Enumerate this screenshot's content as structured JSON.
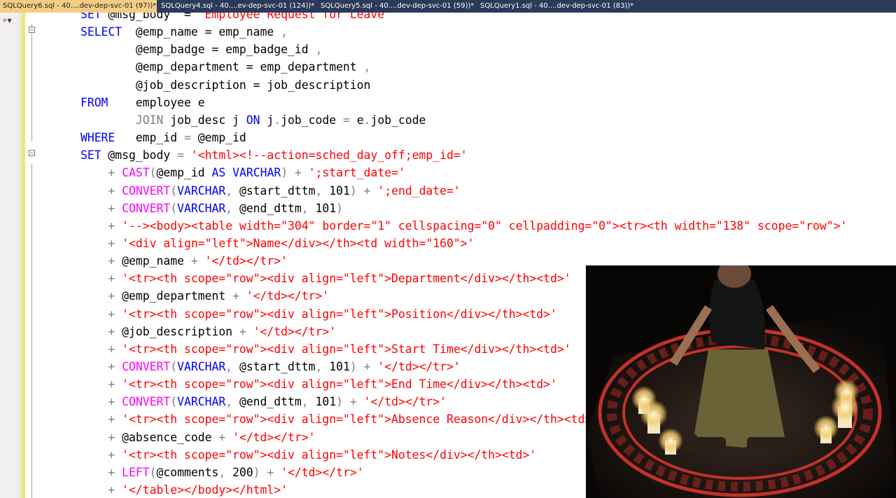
{
  "tabs": [
    {
      "label": "SQLQuery6.sql - 40....dev-dep-svc-01 (97))*",
      "active": true
    },
    {
      "label": "SQLQuery4.sql - 40....ev-dep-svc-01 (124))*",
      "active": false
    },
    {
      "label": "SQLQuery5.sql - 40....dev-dep-svc-01 (59))*",
      "active": false
    },
    {
      "label": "SQLQuery1.sql - 40....dev-dep-svc-01 (83))*",
      "active": false
    }
  ],
  "code_lines": [
    [
      [
        "",
        "        "
      ],
      [
        "kw",
        "SET"
      ],
      [
        "",
        " @msg_body  = "
      ],
      [
        "str",
        "'Employee Request for Leave'"
      ]
    ],
    [
      [
        "",
        "        "
      ],
      [
        "kw",
        "SELECT"
      ],
      [
        "",
        "  @emp_name = emp_name "
      ],
      [
        "gray",
        ","
      ]
    ],
    [
      [
        "",
        "                "
      ],
      [
        "",
        "@emp_badge = emp_badge_id "
      ],
      [
        "gray",
        ","
      ]
    ],
    [
      [
        "",
        "                "
      ],
      [
        "",
        "@emp_department = emp_department "
      ],
      [
        "gray",
        ","
      ]
    ],
    [
      [
        "",
        "                "
      ],
      [
        "",
        "@job_description = job_description"
      ]
    ],
    [
      [
        "",
        "        "
      ],
      [
        "kw",
        "FROM"
      ],
      [
        "",
        "    employee e"
      ]
    ],
    [
      [
        "",
        "                "
      ],
      [
        "gray",
        "JOIN"
      ],
      [
        "",
        " job_desc j "
      ],
      [
        "kw",
        "ON"
      ],
      [
        "",
        " j"
      ],
      [
        "gray",
        "."
      ],
      [
        "",
        "job_code "
      ],
      [
        "gray",
        "="
      ],
      [
        "",
        " e"
      ],
      [
        "gray",
        "."
      ],
      [
        "",
        "job_code"
      ]
    ],
    [
      [
        "",
        "        "
      ],
      [
        "kw",
        "WHERE"
      ],
      [
        "",
        "   emp_id "
      ],
      [
        "gray",
        "="
      ],
      [
        "",
        " @emp_id"
      ]
    ],
    [
      [
        "",
        "        "
      ],
      [
        "kw",
        "SET"
      ],
      [
        "",
        " @msg_body "
      ],
      [
        "gray",
        "="
      ],
      [
        "",
        " "
      ],
      [
        "str",
        "'<html><!--action=sched_day_off;emp_id='"
      ]
    ],
    [
      [
        "",
        "            "
      ],
      [
        "gray",
        "+"
      ],
      [
        "",
        " "
      ],
      [
        "fn",
        "CAST"
      ],
      [
        "gray",
        "("
      ],
      [
        "",
        "@emp_id "
      ],
      [
        "kw",
        "AS"
      ],
      [
        "",
        " "
      ],
      [
        "kw",
        "VARCHAR"
      ],
      [
        "gray",
        ")"
      ],
      [
        "",
        " "
      ],
      [
        "gray",
        "+"
      ],
      [
        "",
        " "
      ],
      [
        "str",
        "';start_date='"
      ]
    ],
    [
      [
        "",
        "            "
      ],
      [
        "gray",
        "+"
      ],
      [
        "",
        " "
      ],
      [
        "fn",
        "CONVERT"
      ],
      [
        "gray",
        "("
      ],
      [
        "kw",
        "VARCHAR"
      ],
      [
        "gray",
        ","
      ],
      [
        "",
        " @start_dttm"
      ],
      [
        "gray",
        ","
      ],
      [
        "",
        " 101"
      ],
      [
        "gray",
        ")"
      ],
      [
        "",
        " "
      ],
      [
        "gray",
        "+"
      ],
      [
        "",
        " "
      ],
      [
        "str",
        "';end_date='"
      ]
    ],
    [
      [
        "",
        "            "
      ],
      [
        "gray",
        "+"
      ],
      [
        "",
        " "
      ],
      [
        "fn",
        "CONVERT"
      ],
      [
        "gray",
        "("
      ],
      [
        "kw",
        "VARCHAR"
      ],
      [
        "gray",
        ","
      ],
      [
        "",
        " @end_dttm"
      ],
      [
        "gray",
        ","
      ],
      [
        "",
        " 101"
      ],
      [
        "gray",
        ")"
      ]
    ],
    [
      [
        "",
        "            "
      ],
      [
        "gray",
        "+"
      ],
      [
        "",
        " "
      ],
      [
        "str",
        "'--><body><table width=\"304\" border=\"1\" cellspacing=\"0\" cellpadding=\"0\"><tr><th width=\"138\" scope=\"row\">'"
      ]
    ],
    [
      [
        "",
        "            "
      ],
      [
        "gray",
        "+"
      ],
      [
        "",
        " "
      ],
      [
        "str",
        "'<div align=\"left\">Name</div></th><td width=\"160\">'"
      ]
    ],
    [
      [
        "",
        "            "
      ],
      [
        "gray",
        "+"
      ],
      [
        "",
        " @emp_name "
      ],
      [
        "gray",
        "+"
      ],
      [
        "",
        " "
      ],
      [
        "str",
        "'</td></tr>'"
      ]
    ],
    [
      [
        "",
        "            "
      ],
      [
        "gray",
        "+"
      ],
      [
        "",
        " "
      ],
      [
        "str",
        "'<tr><th scope=\"row\"><div align=\"left\">Department</div></th><td>'"
      ]
    ],
    [
      [
        "",
        "            "
      ],
      [
        "gray",
        "+"
      ],
      [
        "",
        " @emp_department "
      ],
      [
        "gray",
        "+"
      ],
      [
        "",
        " "
      ],
      [
        "str",
        "'</td></tr>'"
      ]
    ],
    [
      [
        "",
        "            "
      ],
      [
        "gray",
        "+"
      ],
      [
        "",
        " "
      ],
      [
        "str",
        "'<tr><th scope=\"row\"><div align=\"left\">Position</div></th><td>'"
      ]
    ],
    [
      [
        "",
        "            "
      ],
      [
        "gray",
        "+"
      ],
      [
        "",
        " @job_description "
      ],
      [
        "gray",
        "+"
      ],
      [
        "",
        " "
      ],
      [
        "str",
        "'</td></tr>'"
      ]
    ],
    [
      [
        "",
        "            "
      ],
      [
        "gray",
        "+"
      ],
      [
        "",
        " "
      ],
      [
        "str",
        "'<tr><th scope=\"row\"><div align=\"left\">Start Time</div></th><td>'"
      ]
    ],
    [
      [
        "",
        "            "
      ],
      [
        "gray",
        "+"
      ],
      [
        "",
        " "
      ],
      [
        "fn",
        "CONVERT"
      ],
      [
        "gray",
        "("
      ],
      [
        "kw",
        "VARCHAR"
      ],
      [
        "gray",
        ","
      ],
      [
        "",
        " @start_dttm"
      ],
      [
        "gray",
        ","
      ],
      [
        "",
        " 101"
      ],
      [
        "gray",
        ")"
      ],
      [
        "",
        " "
      ],
      [
        "gray",
        "+"
      ],
      [
        "",
        " "
      ],
      [
        "str",
        "'</td></tr>'"
      ]
    ],
    [
      [
        "",
        "            "
      ],
      [
        "gray",
        "+"
      ],
      [
        "",
        " "
      ],
      [
        "str",
        "'<tr><th scope=\"row\"><div align=\"left\">End Time</div></th><td>'"
      ]
    ],
    [
      [
        "",
        "            "
      ],
      [
        "gray",
        "+"
      ],
      [
        "",
        " "
      ],
      [
        "fn",
        "CONVERT"
      ],
      [
        "gray",
        "("
      ],
      [
        "kw",
        "VARCHAR"
      ],
      [
        "gray",
        ","
      ],
      [
        "",
        " @end_dttm"
      ],
      [
        "gray",
        ","
      ],
      [
        "",
        " 101"
      ],
      [
        "gray",
        ")"
      ],
      [
        "",
        " "
      ],
      [
        "gray",
        "+"
      ],
      [
        "",
        " "
      ],
      [
        "str",
        "'</td></tr>'"
      ]
    ],
    [
      [
        "",
        "            "
      ],
      [
        "gray",
        "+"
      ],
      [
        "",
        " "
      ],
      [
        "str",
        "'<tr><th scope=\"row\"><div align=\"left\">Absence Reason</div></th><td>'"
      ]
    ],
    [
      [
        "",
        "            "
      ],
      [
        "gray",
        "+"
      ],
      [
        "",
        " @absence_code "
      ],
      [
        "gray",
        "+"
      ],
      [
        "",
        " "
      ],
      [
        "str",
        "'</td></tr>'"
      ]
    ],
    [
      [
        "",
        "            "
      ],
      [
        "gray",
        "+"
      ],
      [
        "",
        " "
      ],
      [
        "str",
        "'<tr><th scope=\"row\"><div align=\"left\">Notes</div></th><td>'"
      ]
    ],
    [
      [
        "",
        "            "
      ],
      [
        "gray",
        "+"
      ],
      [
        "",
        " "
      ],
      [
        "fn",
        "LEFT"
      ],
      [
        "gray",
        "("
      ],
      [
        "",
        "@comments"
      ],
      [
        "gray",
        ","
      ],
      [
        "",
        " 200"
      ],
      [
        "gray",
        ")"
      ],
      [
        "",
        " "
      ],
      [
        "gray",
        "+"
      ],
      [
        "",
        " "
      ],
      [
        "str",
        "'</td></tr>'"
      ]
    ],
    [
      [
        "",
        "            "
      ],
      [
        "gray",
        "+"
      ],
      [
        "",
        " "
      ],
      [
        "str",
        "'</table></body></html>'"
      ]
    ]
  ],
  "colors": {
    "keyword": "#0000ff",
    "function": "#ff00ff",
    "string": "#ff0000",
    "operator": "#808080",
    "tab_strip": "#2b3a58",
    "active_tab": "#f5cc84",
    "change_bar": "#f2e57a"
  }
}
